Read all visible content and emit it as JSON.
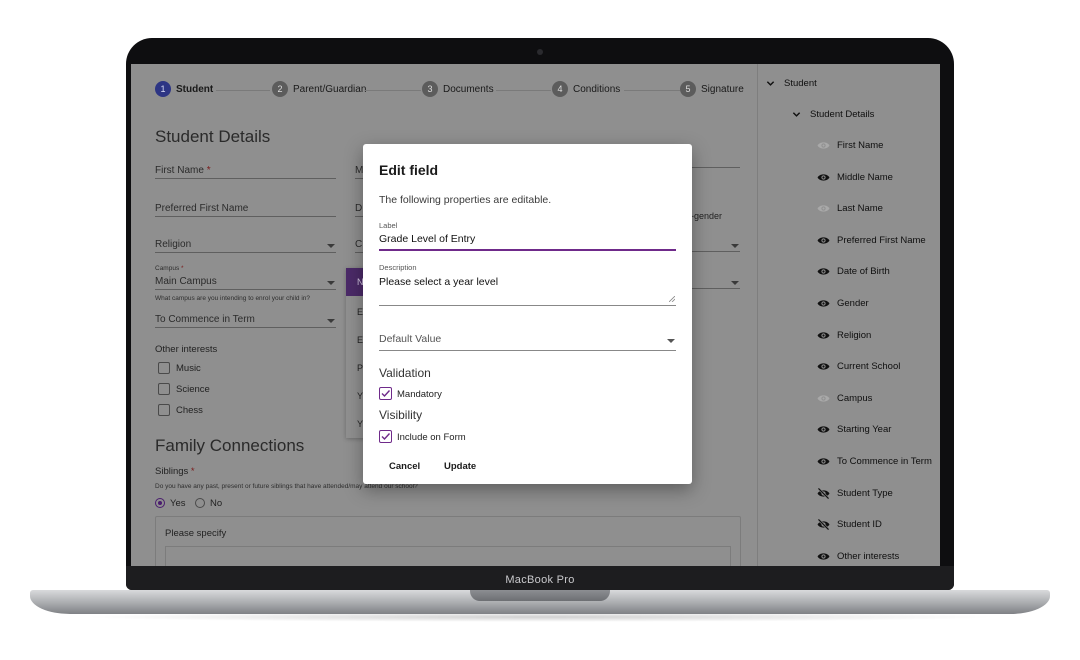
{
  "device": {
    "label": "MacBook Pro"
  },
  "stepper": [
    {
      "num": "1",
      "label": "Student"
    },
    {
      "num": "2",
      "label": "Parent/Guardian"
    },
    {
      "num": "3",
      "label": "Documents"
    },
    {
      "num": "4",
      "label": "Conditions"
    },
    {
      "num": "5",
      "label": "Signature"
    }
  ],
  "form": {
    "section_title": "Student Details",
    "first_name": "First Name",
    "required_mark": "*",
    "preferred_first_name": "Preferred First Name",
    "religion": "Religion",
    "campus_label": "Campus",
    "campus_value": "Main Campus",
    "campus_help": "What campus are you intending to enrol your child in?",
    "commence_term": "To Commence in Term",
    "other_interests": "Other interests",
    "interests": [
      "Music",
      "Science",
      "Chess"
    ],
    "col2_peek": [
      "M",
      "D",
      "C"
    ],
    "gender_peek": "-gender",
    "family_title": "Family Connections",
    "siblings_label": "Siblings",
    "siblings_help": "Do you have any past, present or future siblings that have attended/may attend our school?",
    "yes": "Yes",
    "no": "No",
    "please_specify": "Please specify"
  },
  "popup": {
    "head": "N",
    "items": [
      "E",
      "E",
      "P",
      "Y",
      "Y"
    ]
  },
  "modal": {
    "title": "Edit field",
    "subtitle": "The following properties are editable.",
    "label_caption": "Label",
    "label_value": "Grade Level of Entry",
    "description_caption": "Description",
    "description_value": "Please select a year level",
    "default_value_placeholder": "Default Value",
    "validation_heading": "Validation",
    "mandatory_label": "Mandatory",
    "visibility_heading": "Visibility",
    "include_label": "Include on Form",
    "cancel": "Cancel",
    "update": "Update"
  },
  "panel": {
    "root": "Student",
    "group": "Student Details",
    "items": [
      {
        "label": "First Name",
        "icon": "eye-icon",
        "state": "disabled"
      },
      {
        "label": "Middle Name",
        "icon": "eye-icon",
        "state": "visible"
      },
      {
        "label": "Last Name",
        "icon": "eye-icon",
        "state": "disabled"
      },
      {
        "label": "Preferred First Name",
        "icon": "eye-icon",
        "state": "visible"
      },
      {
        "label": "Date of Birth",
        "icon": "eye-icon",
        "state": "visible"
      },
      {
        "label": "Gender",
        "icon": "eye-icon",
        "state": "visible"
      },
      {
        "label": "Religion",
        "icon": "eye-icon",
        "state": "visible"
      },
      {
        "label": "Current School",
        "icon": "eye-icon",
        "state": "visible"
      },
      {
        "label": "Campus",
        "icon": "eye-icon",
        "state": "disabled"
      },
      {
        "label": "Starting Year",
        "icon": "eye-icon",
        "state": "visible"
      },
      {
        "label": "To Commence in Term",
        "icon": "eye-icon",
        "state": "visible"
      },
      {
        "label": "Student Type",
        "icon": "eye-off-icon",
        "state": "hidden"
      },
      {
        "label": "Student ID",
        "icon": "eye-off-icon",
        "state": "hidden"
      },
      {
        "label": "Other interests",
        "icon": "eye-icon",
        "state": "visible"
      }
    ]
  },
  "colors": {
    "accent": "#6f2a8a",
    "step_active": "#2d3584",
    "overlay": "#8f8f8f"
  }
}
